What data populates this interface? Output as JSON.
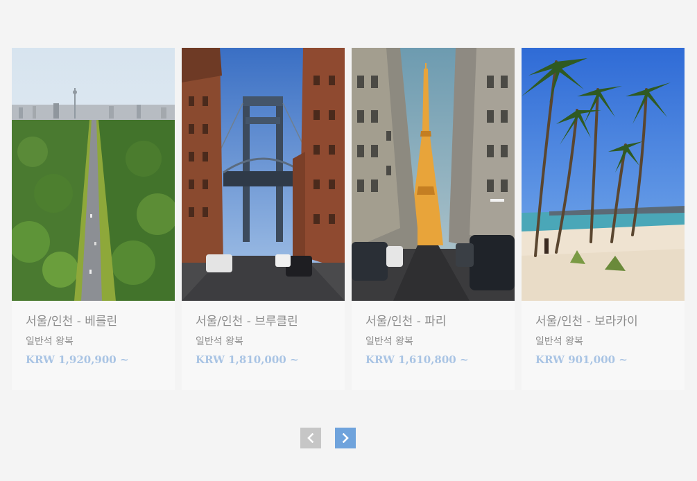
{
  "cards": [
    {
      "title": "서울/인천 - 베를린",
      "sub": "일반석 왕복",
      "price": "KRW 1,920,900 ~",
      "image": "berlin-forest-avenue-photo"
    },
    {
      "title": "서울/인천 - 브루클린",
      "sub": "일반석 왕복",
      "price": "KRW 1,810,000 ~",
      "image": "brooklyn-manhattan-bridge-photo"
    },
    {
      "title": "서울/인천 - 파리",
      "sub": "일반석 왕복",
      "price": "KRW 1,610,800 ~",
      "image": "paris-eiffel-tower-street-photo"
    },
    {
      "title": "서울/인천 - 보라카이",
      "sub": "일반석 왕복",
      "price": "KRW 901,000 ~",
      "image": "boracay-palm-beach-photo"
    }
  ],
  "pagination": {
    "prev_icon": "chevron-left-icon",
    "next_icon": "chevron-right-icon"
  },
  "colors": {
    "accent": "#6fa3dc",
    "price": "#a9c4e4",
    "disabled": "#c6c6c6",
    "text": "#8c8c8c"
  }
}
